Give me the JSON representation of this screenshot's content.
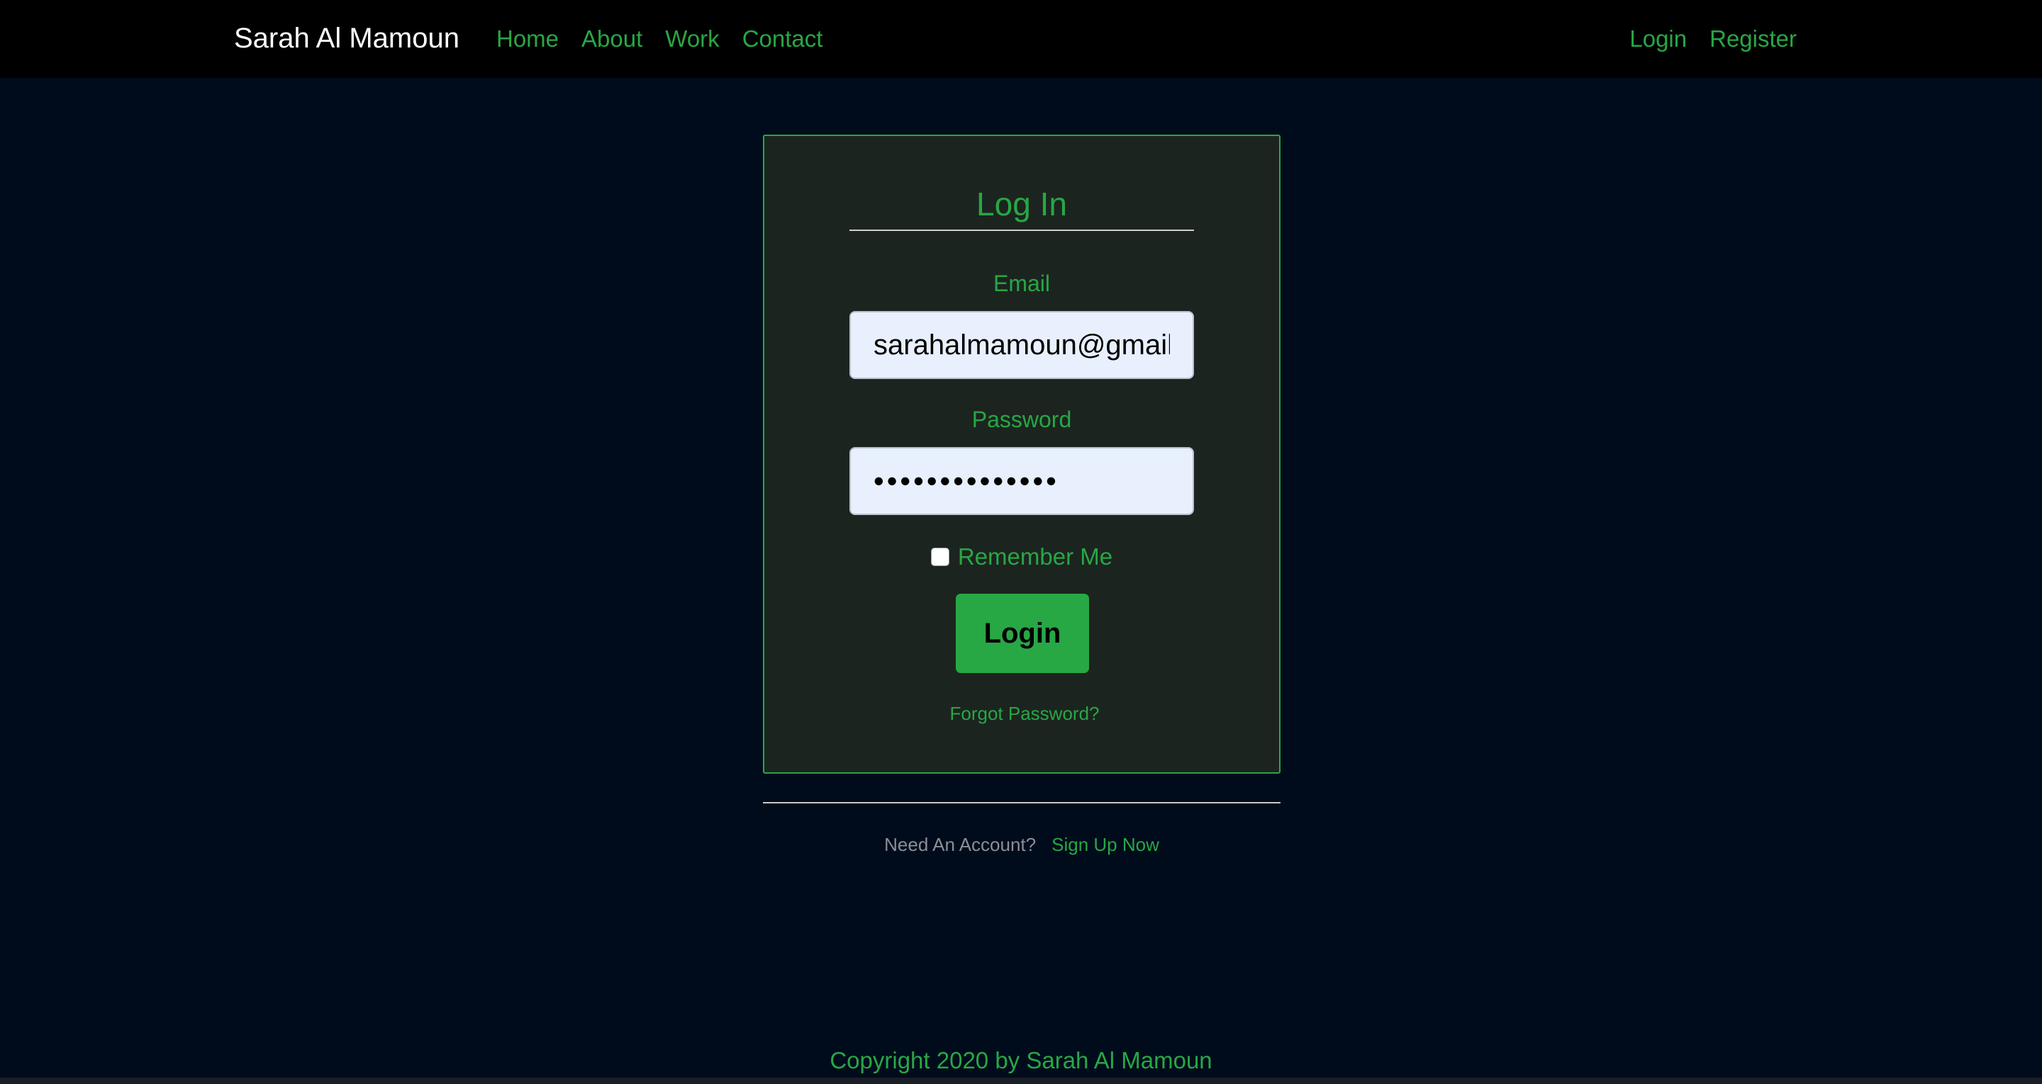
{
  "nav": {
    "brand": "Sarah Al Mamoun",
    "links": [
      "Home",
      "About",
      "Work",
      "Contact"
    ],
    "auth_links": [
      "Login",
      "Register"
    ]
  },
  "login_form": {
    "title": "Log In",
    "email_label": "Email",
    "email_value": "sarahalmamoun@gmail",
    "password_label": "Password",
    "password_mask": "••••••••••••••",
    "remember_label": "Remember Me",
    "remember_checked": false,
    "submit_label": "Login",
    "forgot_label": "Forgot Password?"
  },
  "signup": {
    "prompt": "Need An Account?",
    "link_label": "Sign Up Now"
  },
  "footer": {
    "text": "Copyright 2020 by Sarah Al Mamoun"
  },
  "colors": {
    "accent": "#28a745",
    "background": "#000c1c",
    "navbar": "#000000",
    "card": "#1c2420"
  }
}
